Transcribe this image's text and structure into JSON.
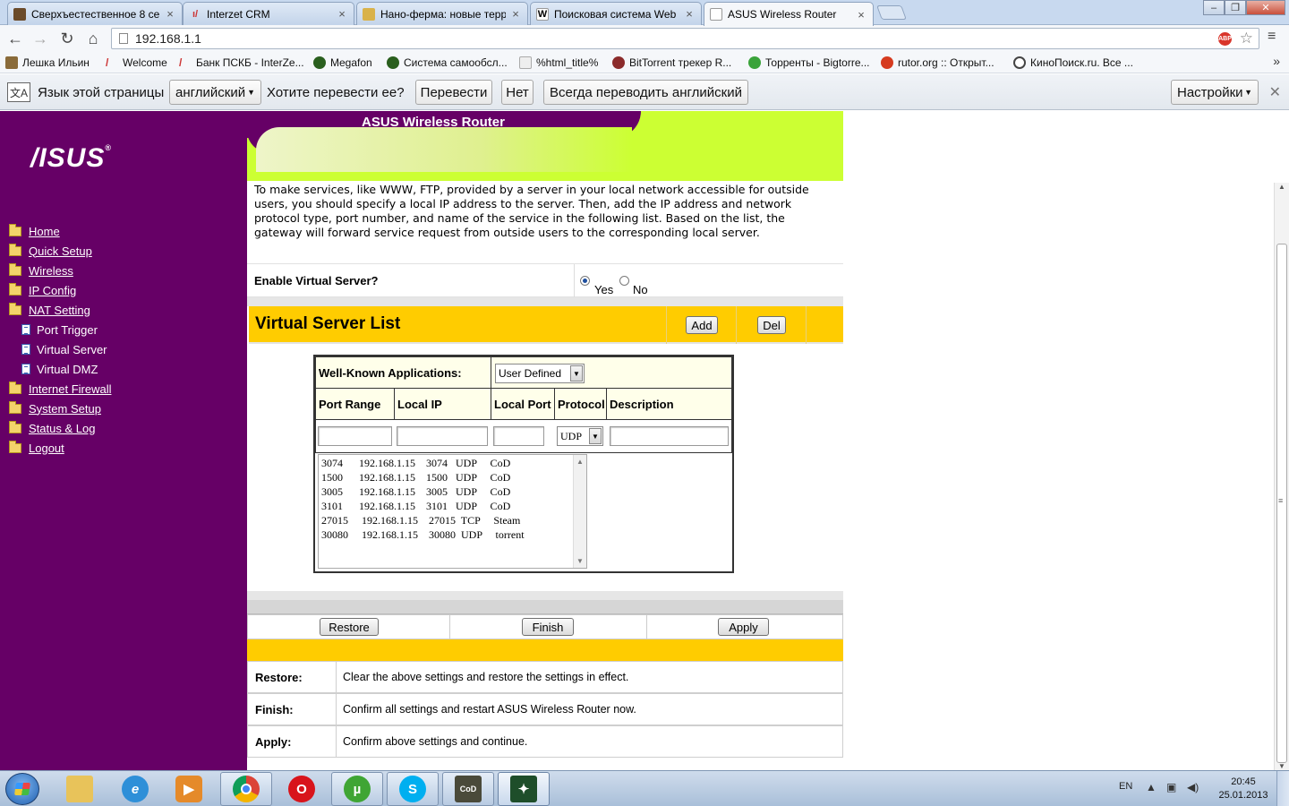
{
  "browser": {
    "tabs": [
      {
        "label": "Сверхъестественное 8 се",
        "active": false
      },
      {
        "label": "Interzet CRM",
        "active": false
      },
      {
        "label": "Нано-ферма: новые терр",
        "active": false
      },
      {
        "label": "Поисковая система Web",
        "active": false
      },
      {
        "label": "ASUS Wireless Router",
        "active": true
      }
    ],
    "url": "192.168.1.1",
    "abp_label": "ABP",
    "bookmarks": [
      "Лешка Ильин",
      "Welcome",
      "Банк ПСКБ - InterZe...",
      "Megafon",
      "Система самообсл...",
      "%html_title%",
      "BitTorrent трекер R...",
      "Торренты - Bigtorre...",
      "rutor.org :: Открыт...",
      "КиноПоиск.ru. Все ..."
    ],
    "bookmarks_more": "»"
  },
  "translate_bar": {
    "page_language_label": "Язык этой страницы",
    "language_value": "английский",
    "question": "Хотите перевести ее?",
    "translate_button": "Перевести",
    "no_button": "Нет",
    "always_button": "Всегда переводить английский",
    "settings_button": "Настройки"
  },
  "router": {
    "logo_text": "/ISUS",
    "header_title": "ASUS Wireless Router",
    "menu": [
      {
        "label": "Home",
        "type": "folder"
      },
      {
        "label": "Quick Setup",
        "type": "folder"
      },
      {
        "label": "Wireless",
        "type": "folder"
      },
      {
        "label": "IP Config",
        "type": "folder"
      },
      {
        "label": "NAT Setting",
        "type": "folder-open"
      },
      {
        "label": "Port Trigger",
        "type": "page"
      },
      {
        "label": "Virtual Server",
        "type": "page"
      },
      {
        "label": "Virtual DMZ",
        "type": "page"
      },
      {
        "label": "Internet Firewall",
        "type": "folder"
      },
      {
        "label": "System Setup",
        "type": "folder"
      },
      {
        "label": "Status & Log",
        "type": "folder"
      },
      {
        "label": "Logout",
        "type": "folder"
      }
    ],
    "intro": "To make services, like WWW, FTP, provided by a server in your local network accessible for outside users, you should specify a local IP address to the server. Then, add the IP address and network protocol type, port number, and name of the service in the following list. Based on the list, the gateway will forward service request from outside users to the corresponding local server.",
    "enable_label": "Enable Virtual Server?",
    "enable_yes": "Yes",
    "enable_no": "No",
    "enable_value": "Yes",
    "list_title": "Virtual Server List",
    "add_button": "Add",
    "del_button": "Del",
    "well_known_label": "Well-Known Applications:",
    "well_known_value": "User Defined",
    "columns": [
      "Port Range",
      "Local IP",
      "Local Port",
      "Protocol",
      "Description"
    ],
    "protocol_value": "UDP",
    "entries": [
      "3074      192.168.1.15    3074   UDP     CoD",
      "1500      192.168.1.15    1500   UDP     CoD",
      "3005      192.168.1.15    3005   UDP     CoD",
      "3101      192.168.1.15    3101   UDP     CoD",
      "27015     192.168.1.15    27015  TCP     Steam",
      "30080     192.168.1.15    30080  UDP     torrent"
    ],
    "restore_button": "Restore",
    "finish_button": "Finish",
    "apply_button": "Apply",
    "help": [
      {
        "key": "Restore:",
        "text": "Clear the above settings and restore the settings in effect."
      },
      {
        "key": "Finish:",
        "text": "Confirm all settings and restart ASUS Wireless Router now."
      },
      {
        "key": "Apply:",
        "text": "Confirm above settings and continue."
      }
    ]
  },
  "taskbar": {
    "apps": [
      "explorer",
      "internet-explorer",
      "media-player",
      "chrome",
      "opera",
      "utorrent",
      "skype",
      "call-of-duty",
      "counter-strike"
    ],
    "language": "EN",
    "time": "20:45",
    "date": "25.01.2013"
  },
  "colors": {
    "sidebar": "#660066",
    "header_green": "#ccff33",
    "accent_yellow": "#ffcc00"
  }
}
